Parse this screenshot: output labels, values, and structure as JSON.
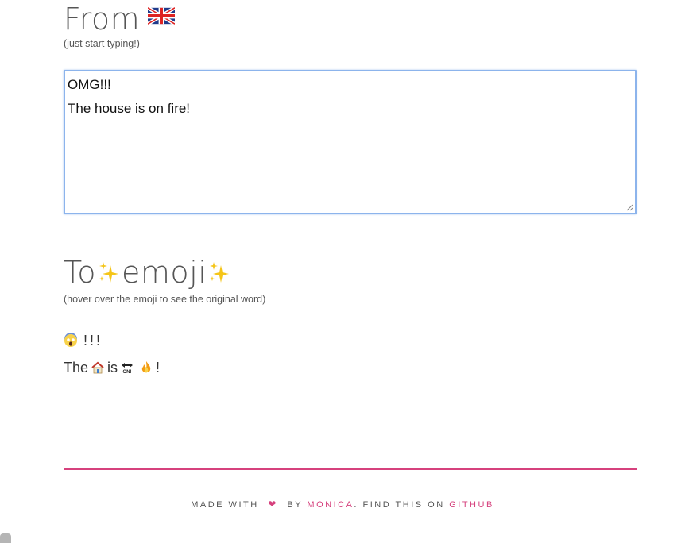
{
  "from": {
    "title": "From",
    "flag_icon": "uk-flag-icon",
    "hint": "(just start typing!)",
    "textarea_lines": [
      "OMG!!!",
      "The house is on fire!"
    ]
  },
  "to": {
    "title_prefix": "To",
    "title_word": "emoji",
    "sparkle_icon": "sparkles-icon",
    "hint": "(hover over the emoji to see the original word)",
    "line1_text": "!!!",
    "line2": {
      "word1": "The",
      "word2": "is",
      "word3": "!"
    },
    "emoji_icons": [
      "scream-face-icon",
      "house-icon",
      "on-arrow-icon",
      "fire-icon"
    ]
  },
  "footer": {
    "made_with": "MADE WITH",
    "by": "BY",
    "author": "MONICA",
    "find_text": ". FIND THIS ON",
    "github": "GITHUB",
    "accent_color": "#d6417d"
  }
}
